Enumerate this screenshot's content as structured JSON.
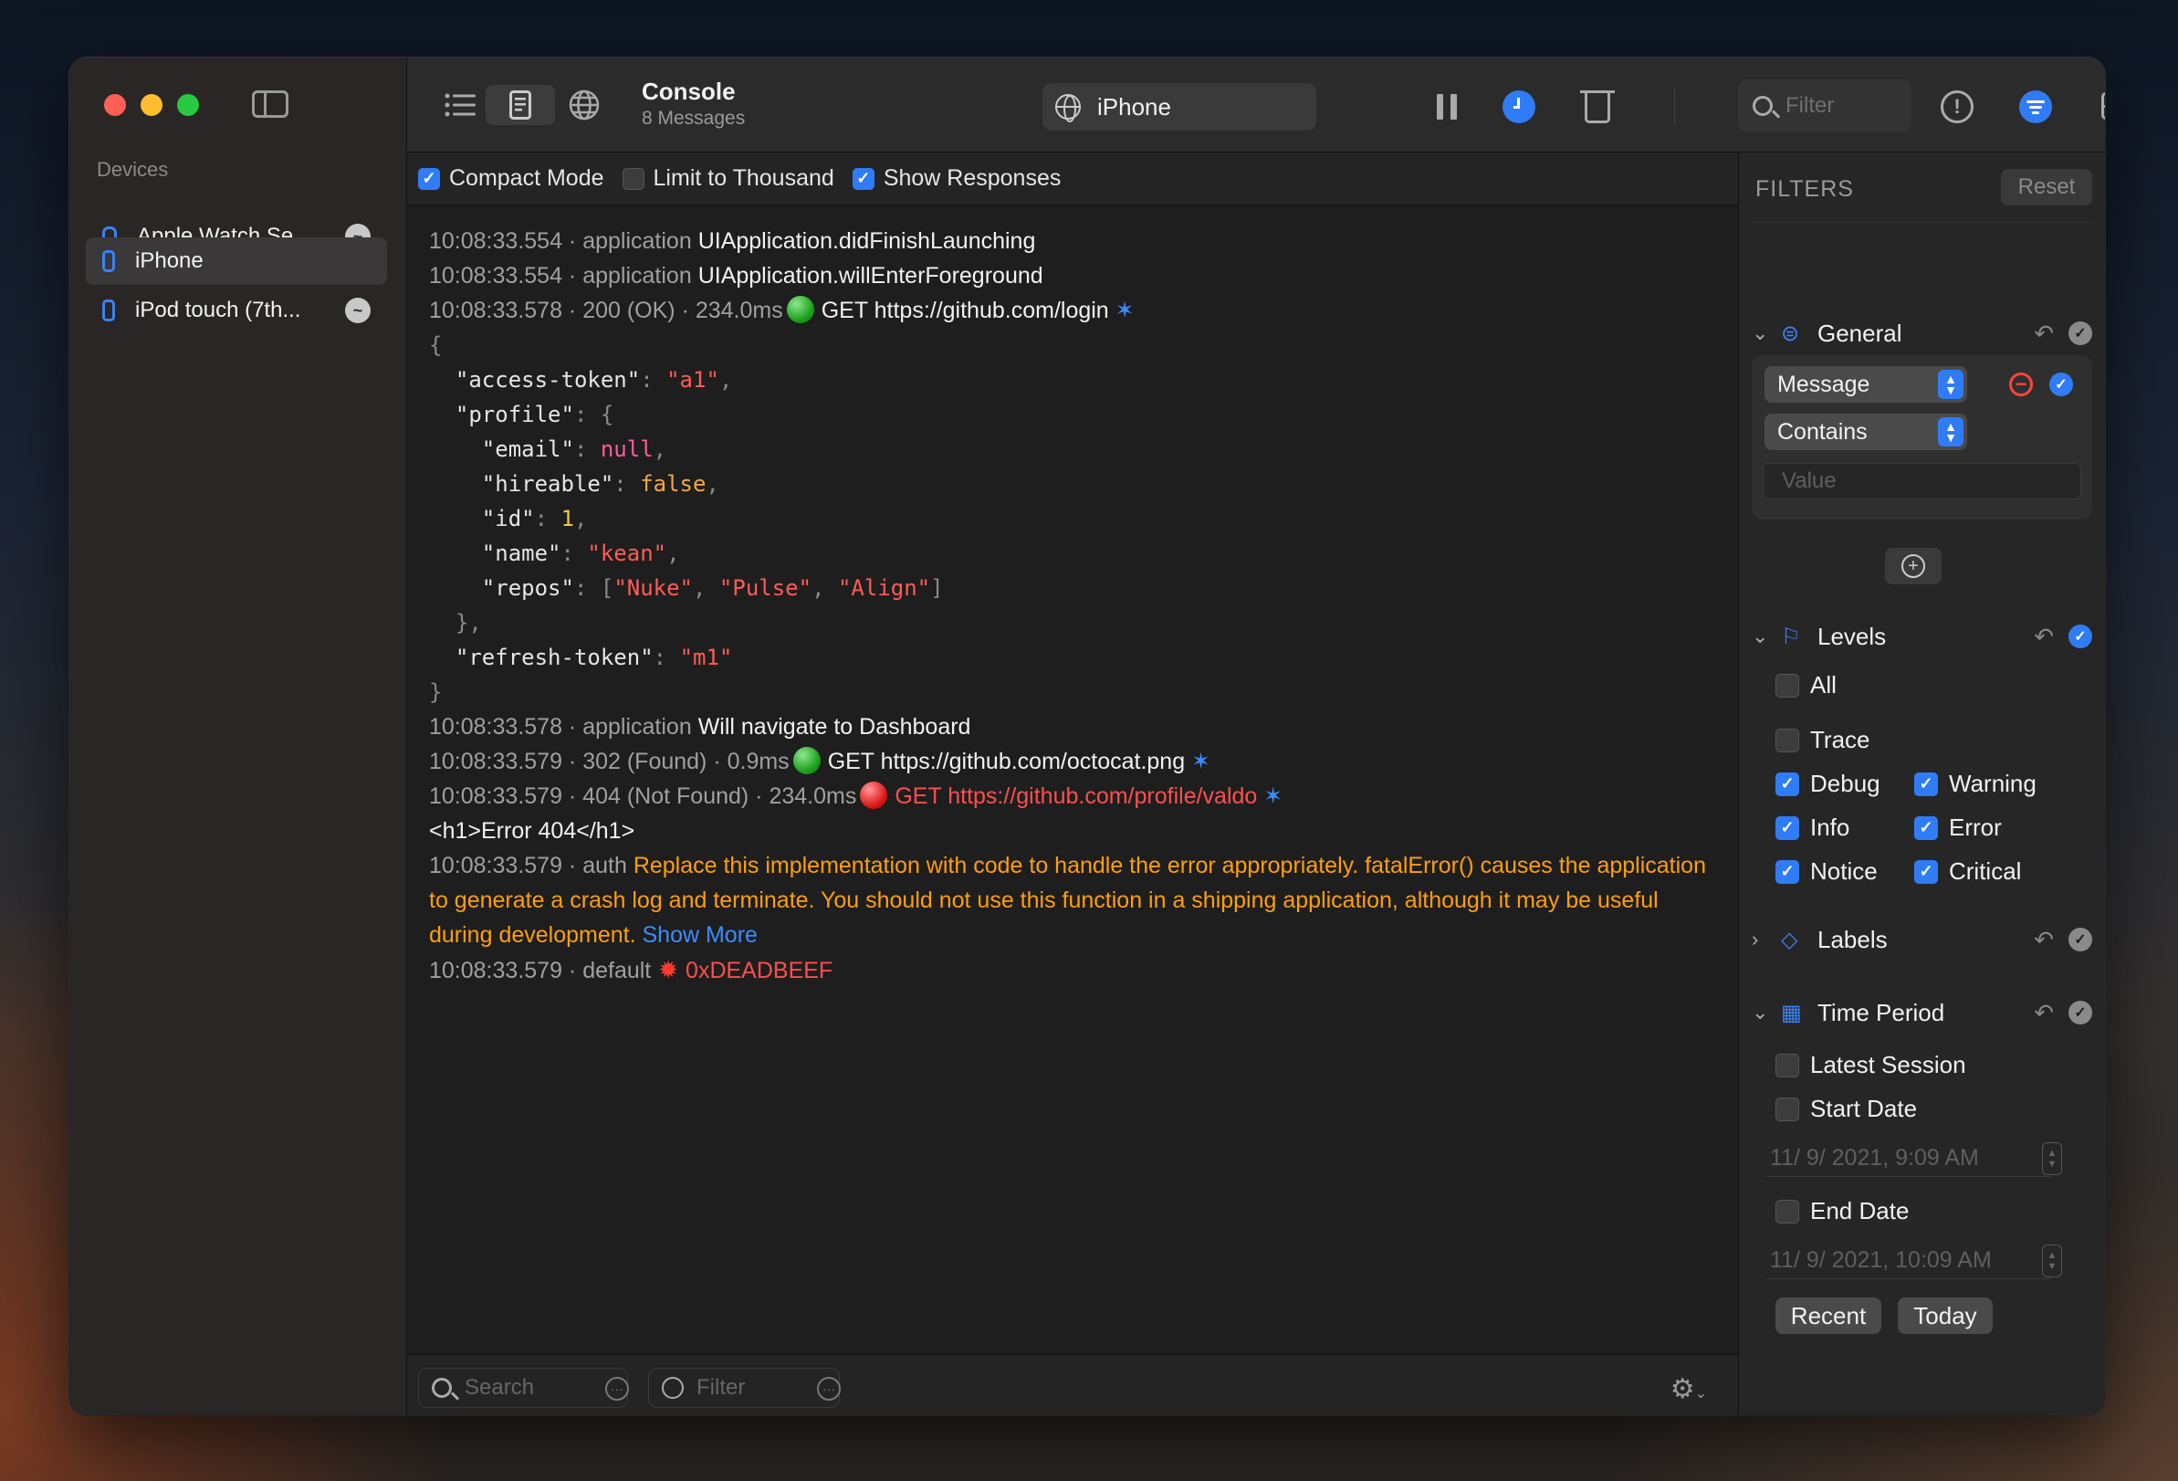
{
  "sidebar": {
    "section_title": "Devices",
    "devices": [
      {
        "name": "Apple Watch Se...",
        "icon": "apple-watch-icon"
      },
      {
        "name": "iPhone",
        "icon": "iphone-icon"
      },
      {
        "name": "iPod touch (7th...",
        "icon": "ipod-icon"
      }
    ]
  },
  "toolbar": {
    "title": "Console",
    "subtitle": "8 Messages",
    "device": "iPhone",
    "filter_placeholder": "Filter"
  },
  "options": {
    "compact_mode": "Compact Mode",
    "limit": "Limit to Thousand",
    "show_responses": "Show Responses"
  },
  "log": {
    "l1_meta": "10:08:33.554 · application",
    "l1_msg": "UIApplication.didFinishLaunching",
    "l2_meta": "10:08:33.554 · application",
    "l2_msg": "UIApplication.willEnterForeground",
    "l3_meta": "10:08:33.578 · 200 (OK) · 234.0ms",
    "l3_msg": "GET https://github.com/login",
    "l4_meta": "10:08:33.578 · application",
    "l4_msg": "Will navigate to Dashboard",
    "l5_meta": "10:08:33.579 · 302 (Found) · 0.9ms",
    "l5_msg": "GET https://github.com/octocat.png",
    "l6_meta": "10:08:33.579 · 404 (Not Found) · 234.0ms",
    "l6_msg": "GET https://github.com/profile/valdo",
    "l7_msg": "<h1>Error 404</h1>",
    "l8_meta": "10:08:33.579 · auth",
    "l8_msg": "Replace this implementation with code to handle the error appropriately. fatalError() causes the application to generate a crash log and terminate. You should not use this function in a shipping application, although it may be useful during development.",
    "show_more": "Show More",
    "l9_meta": "10:08:33.579 · default",
    "l9_msg": "0xDEADBEEF",
    "star": "✶"
  },
  "json": {
    "access_token_key": "\"access-token\"",
    "access_token_val": "\"a1\"",
    "profile_key": "\"profile\"",
    "email_key": "\"email\"",
    "email_val": "null",
    "hireable_key": "\"hireable\"",
    "hireable_val": "false",
    "id_key": "\"id\"",
    "id_val": "1",
    "name_key": "\"name\"",
    "name_val": "\"kean\"",
    "repos_key": "\"repos\"",
    "repo1": "\"Nuke\"",
    "repo2": "\"Pulse\"",
    "repo3": "\"Align\"",
    "refresh_key": "\"refresh-token\"",
    "refresh_val": "\"m1\""
  },
  "bottom": {
    "search_placeholder": "Search",
    "filter_placeholder": "Filter"
  },
  "filters": {
    "header": "FILTERS",
    "reset": "Reset",
    "general": "General",
    "field": "Message",
    "match": "Contains",
    "value_placeholder": "Value",
    "levels": "Levels",
    "all": "All",
    "trace": "Trace",
    "debug": "Debug",
    "warning": "Warning",
    "info": "Info",
    "error": "Error",
    "notice": "Notice",
    "critical": "Critical",
    "labels": "Labels",
    "time_period": "Time Period",
    "latest_session": "Latest Session",
    "start_date": "Start Date",
    "start_value": "11/  9/ 2021,   9:09 AM",
    "end_date": "End Date",
    "end_value": "11/  9/ 2021, 10:09 AM",
    "recent": "Recent",
    "today": "Today"
  },
  "colors": {
    "accent": "#2f7cf6",
    "error": "#ff4f4f",
    "warning": "#ff9f0a"
  }
}
